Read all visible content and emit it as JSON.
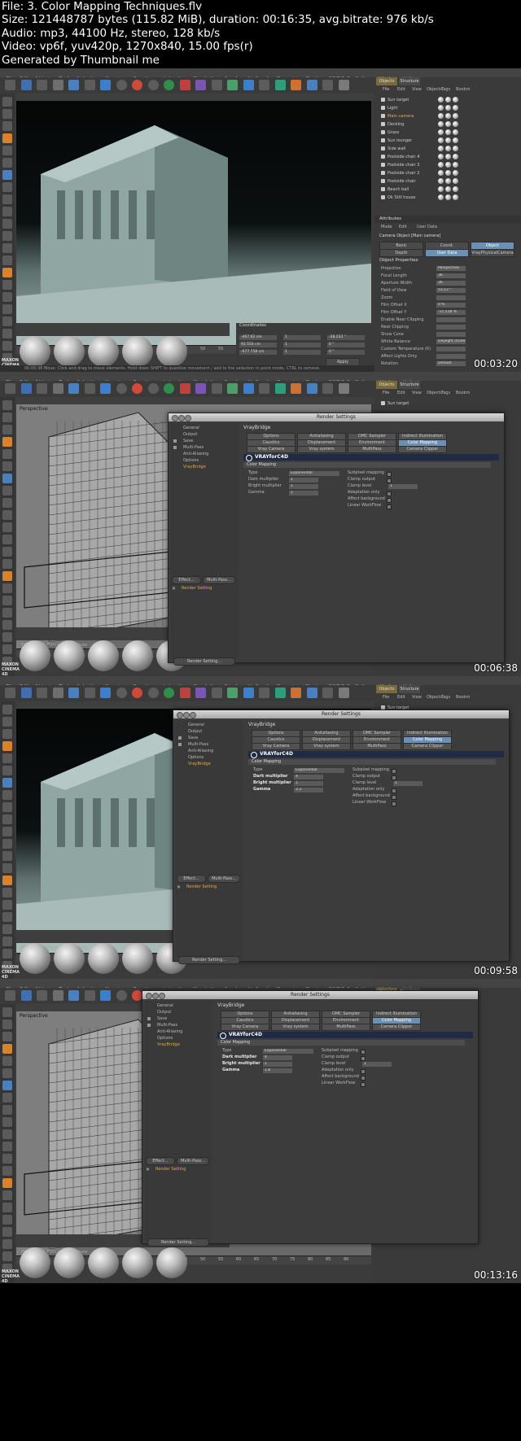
{
  "header": {
    "file": "File: 3. Color Mapping Techniques.flv",
    "size": "Size: 121448787 bytes (115.82 MiB), duration: 00:16:35, avg.bitrate: 976 kb/s",
    "audio": "Audio: mp3, 44100 Hz, stereo, 128 kb/s",
    "video": "Video: vp6f, yuv420p, 1270x840, 15.00 fps(r)",
    "generated": "Generated by Thumbnail me"
  },
  "menu": [
    "File",
    "Edit",
    "Objects",
    "Tools",
    "Selection",
    "Structure",
    "Functions",
    "Animation",
    "Simulation",
    "Render",
    "MoGraph",
    "Character",
    "Plugins",
    "DPIT Full",
    "Python",
    "Window",
    "Help"
  ],
  "viewport_menu": [
    "Edit",
    "Cameras",
    "Display",
    "Filter",
    "View"
  ],
  "perspective_label": "Perspective",
  "materials": {
    "title": "Materials",
    "menu": [
      "File",
      "Edit",
      "Function",
      "Texture"
    ]
  },
  "coordinates": {
    "title": "Coordinates",
    "headers": [
      "Position",
      "Scale",
      "Rotation"
    ],
    "rows": [
      {
        "p": "-467.62 cm",
        "s": "1",
        "r": "-28.233 °"
      },
      {
        "p": "92.554 cm",
        "s": "1",
        "r": "0 °"
      },
      {
        "p": "-677.758 cm",
        "s": "1",
        "r": "0 °"
      }
    ],
    "mode": "Object (Rel)",
    "size_mode": "Scale",
    "apply": "Apply"
  },
  "status_text": "00:00:36   Move: Click and drag to move elements. Hold down SHIFT to quantize movement / add to the selection in point mode, CTRL to remove.",
  "objects": {
    "tabs": [
      "Objects",
      "Structure"
    ],
    "menu": [
      "File",
      "Edit",
      "View",
      "Objects",
      "Tags",
      "Bookm"
    ],
    "items": [
      "Sun target",
      "Light",
      "Main camera",
      "Decking",
      "Grass",
      "Sun lounger",
      "Side wall",
      "Poolside chair 4",
      "Poolside chair 3",
      "Poolside chair 2",
      "Poolside chair",
      "Beach ball",
      "Ok Still house"
    ]
  },
  "attributes": {
    "title": "Attributes",
    "menu": [
      "Mode",
      "Edit",
      "User Data"
    ],
    "object": "Camera Object [Main camera]",
    "tabs": [
      "Basic",
      "Coord.",
      "Object",
      "Depth",
      "User Data",
      "VrayPhysicalCamera"
    ],
    "section": "Object Properties",
    "props": [
      {
        "k": "Projection",
        "v": "Perspective"
      },
      {
        "k": "Focal Length",
        "v": "36"
      },
      {
        "k": "Aperture Width",
        "v": "36"
      },
      {
        "k": "Field of View",
        "v": "53.13 °"
      },
      {
        "k": "Zoom",
        "v": ""
      },
      {
        "k": "Film Offset X",
        "v": "0 %"
      },
      {
        "k": "Film Offset Y",
        "v": "-11.538 %"
      },
      {
        "k": "Enable Near Clipping",
        "v": ""
      },
      {
        "k": "Near Clipping",
        "v": ""
      },
      {
        "k": "Show Cone",
        "v": ""
      },
      {
        "k": "White Balance",
        "v": "Daylight (6500 K)"
      },
      {
        "k": "Custom Temperature (K)",
        "v": ""
      },
      {
        "k": "Affect Lights Only",
        "v": ""
      },
      {
        "k": "Rotation",
        "v": "Default"
      }
    ]
  },
  "render_settings": {
    "title": "Render Settings",
    "left_items": [
      "General",
      "Output",
      "Save",
      "Multi-Pass",
      "Anti-Aliasing",
      "Options",
      "VrayBridge"
    ],
    "effect_btn": "Effect...",
    "multipass_btn": "Multi-Pass...",
    "render_setting": "Render Setting",
    "footer_btn": "Render Setting...",
    "vb_title": "VrayBridge",
    "tabs_row1": [
      "Options",
      "Antialiasing",
      "DMC Sampler",
      "Indirect Illumination (GI)"
    ],
    "tabs_row2": [
      "Caustics",
      "Displacement",
      "Environment",
      "Color Mapping"
    ],
    "tabs_row3": [
      "Vray Camera",
      "Vray system",
      "MultiPass",
      "Camera Clipper"
    ],
    "logo": "VRAYforC4D",
    "section": "Color Mapping",
    "left_labels": [
      "Type",
      "Dark multiplier",
      "Bright multiplier",
      "Gamma"
    ],
    "right_labels": [
      "Subpixel mapping",
      "Clamp output",
      "Clamp level",
      "Adaptation only",
      "Affect background",
      "Linear WorkFlow"
    ],
    "frames": [
      {
        "type": "Exponential",
        "dark": "1",
        "bright": "1",
        "gamma": "1",
        "clamp": "1"
      },
      {
        "type": "Exponential",
        "dark": "4",
        "bright": "1",
        "gamma": "3.3",
        "clamp": "1"
      },
      {
        "type": "Exponential",
        "dark": "4",
        "bright": "1",
        "gamma": "1.8",
        "clamp": "1"
      }
    ]
  },
  "timestamps": [
    "00:03:20",
    "00:06:38",
    "00:09:58",
    "00:13:16"
  ],
  "timeline_ticks": [
    "0",
    "5",
    "10",
    "15",
    "20",
    "25",
    "30",
    "35",
    "40",
    "45",
    "50",
    "55",
    "60",
    "65",
    "70",
    "75",
    "80",
    "85",
    "90"
  ],
  "maxon_label": "MAXON CINEMA 4D",
  "colors": {
    "accent": "#6c8fb5",
    "highlight": "#e8a64a",
    "panel": "#3b3b3b"
  }
}
